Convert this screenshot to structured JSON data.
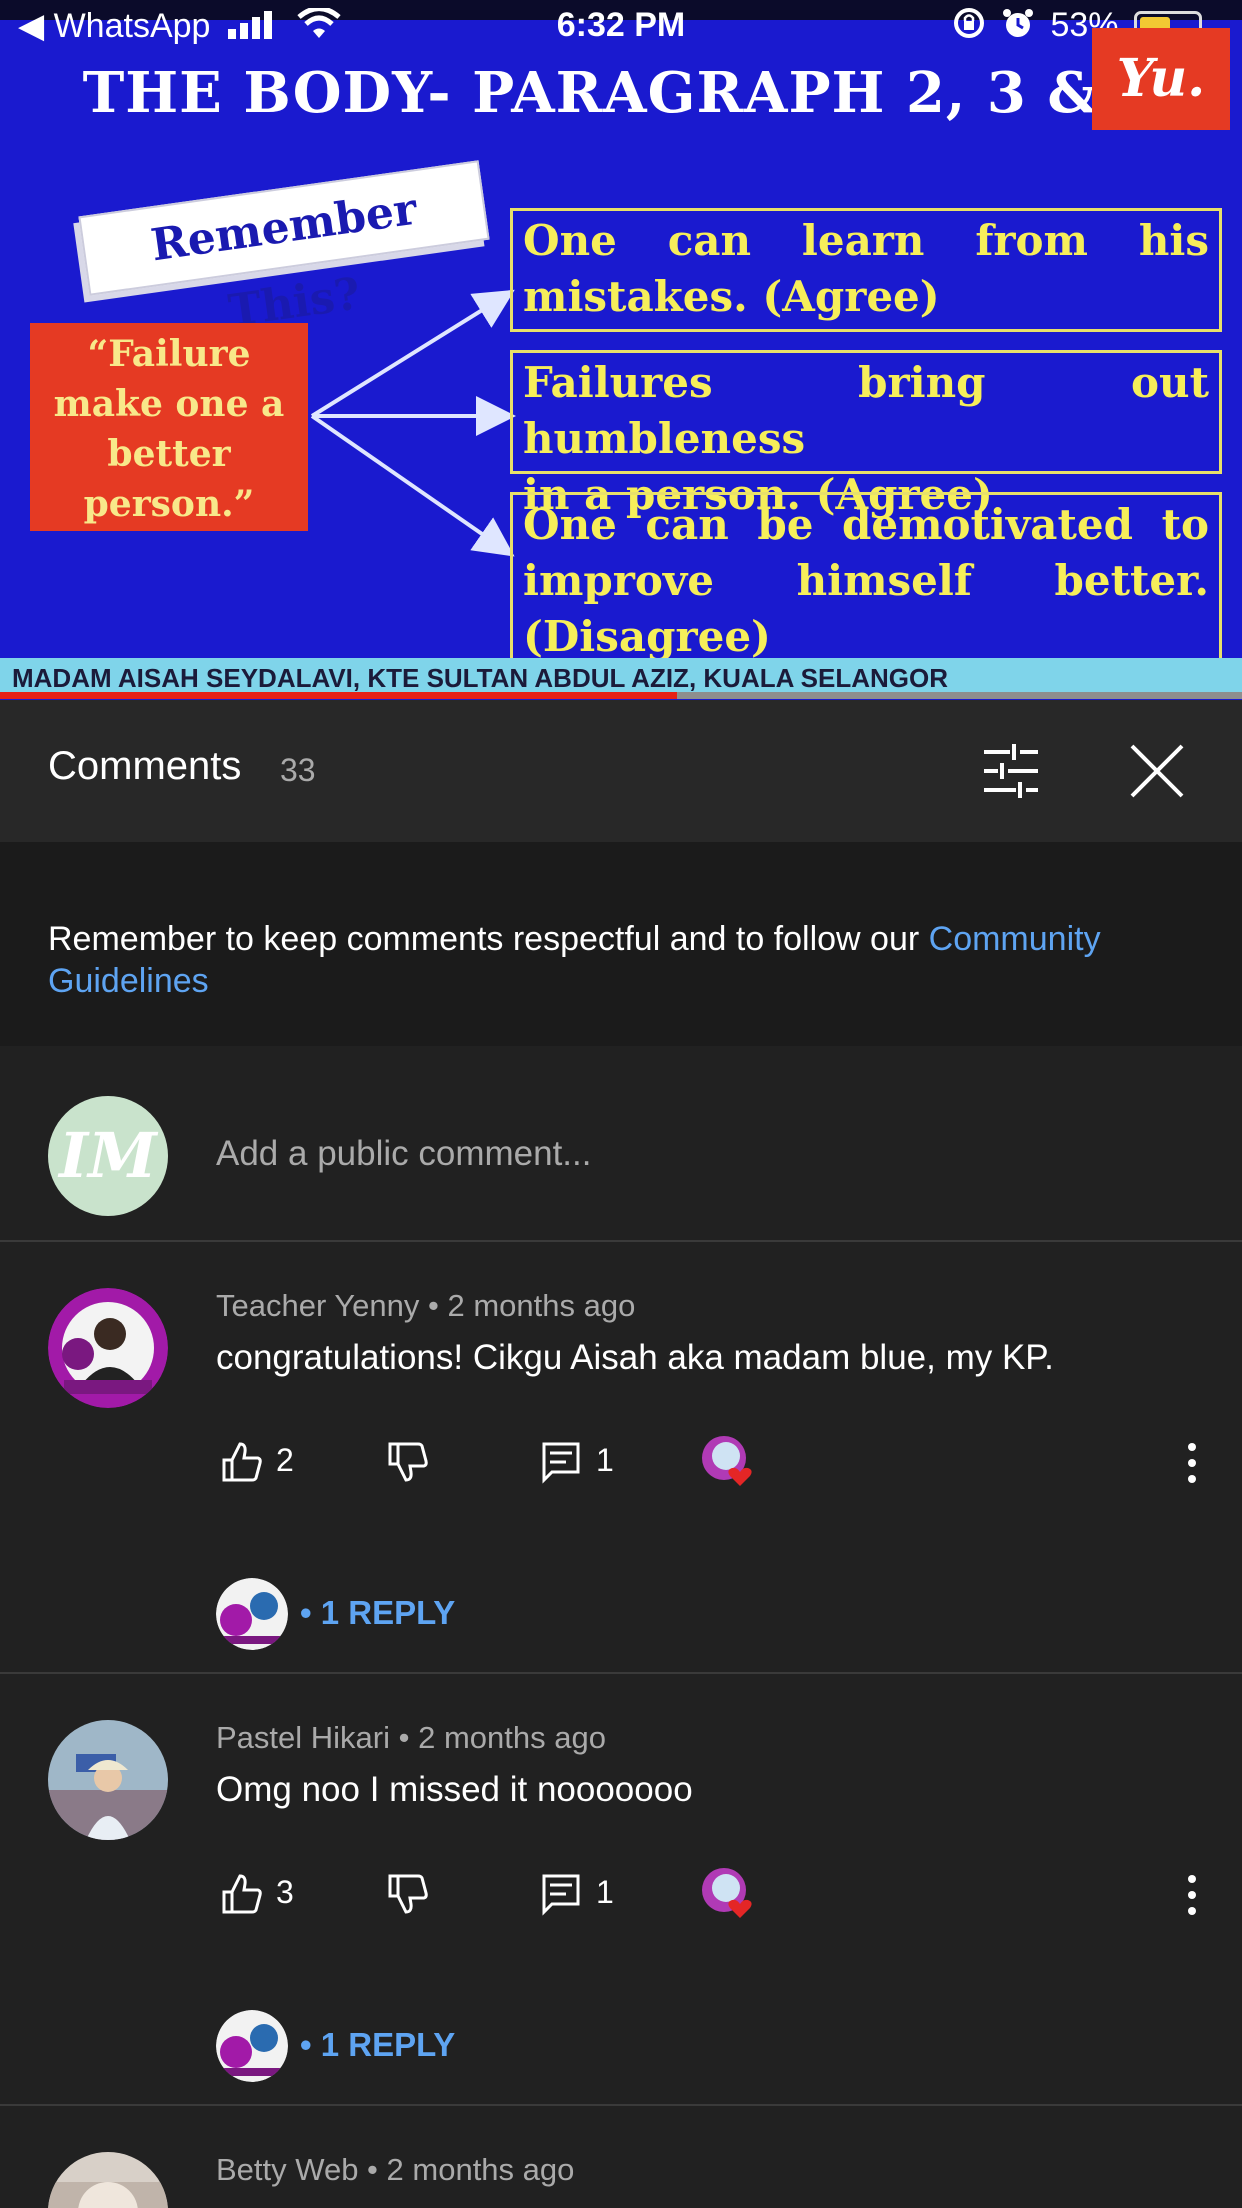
{
  "status_bar": {
    "back_app": "◀ WhatsApp",
    "time": "6:32 PM",
    "battery": "53%"
  },
  "video": {
    "slide_title": "THE BODY- PARAGRAPH 2, 3 & 4",
    "logo": "Yu.",
    "remember_label": "Remember This?",
    "quote": [
      "“Failure",
      "make one a",
      "better",
      "person.”"
    ],
    "points": [
      [
        "One can learn from his",
        "mistakes. (Agree)"
      ],
      [
        "Failures bring out humbleness",
        "in a person. (Agree)"
      ],
      [
        "One can be demotivated to",
        "improve himself better.",
        "(Disagree)"
      ]
    ],
    "ticker": "MADAM AISAH SEYDALAVI, KTE SULTAN ABDUL AZIZ, KUALA SELANGOR",
    "progress": 0.545
  },
  "comments_header": {
    "title": "Comments",
    "count": "33"
  },
  "guidelines": {
    "text": "Remember to keep comments respectful and to follow our ",
    "link": "Community Guidelines"
  },
  "add_comment": {
    "avatar_initials": "IM",
    "placeholder": "Add a public comment..."
  },
  "comments": [
    {
      "author": "Teacher Yenny",
      "time": "2 months ago",
      "text": "congratulations! Cikgu Aisah aka madam blue, my KP.",
      "likes": "2",
      "replies_count": "1",
      "reply_label": "• 1 REPLY"
    },
    {
      "author": "Pastel Hikari",
      "time": "2 months ago",
      "text": "Omg noo I missed it nooooooo",
      "likes": "3",
      "replies_count": "1",
      "reply_label": "• 1 REPLY"
    },
    {
      "author": "Betty Web",
      "time": "2 months ago"
    }
  ],
  "colors": {
    "accent_blue": "#5ea4f2",
    "video_bg": "#1a1acf",
    "slide_red": "#e53a23",
    "slide_yellow": "#f6ee5a",
    "progress_red": "#e62117"
  }
}
